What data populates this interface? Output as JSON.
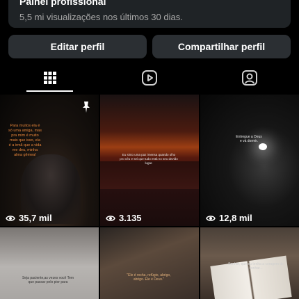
{
  "professional_panel": {
    "title": "Painel profissional",
    "subtitle": "5,5 mi visualizações nos últimos 30 dias."
  },
  "actions": {
    "edit_profile": "Editar perfil",
    "share_profile": "Compartilhar perfil"
  },
  "tabs": [
    {
      "icon": "grid-icon",
      "active": true
    },
    {
      "icon": "reels-icon",
      "active": false
    },
    {
      "icon": "tagged-icon",
      "active": false
    }
  ],
  "posts": [
    {
      "views": "35,7 mil",
      "pinned": true,
      "overlay_text": "Para muitos ela é só uma amiga, mas pra mim é muito mais que isso, ela é a irmã que a vida me deu, minha alma gêmea!"
    },
    {
      "views": "3.135",
      "overlay_text": "Eu sinto uma paz imensa quando olho pro céu e sei que tudo está no seu devido lugar."
    },
    {
      "views": "12,8 mil",
      "overlay_text": "Entregue a Deus e vá dormir."
    },
    {
      "overlay_text": "Seja paciente,as vezes você Tem que passar pelo pior para"
    },
    {
      "overlay_text": "\"Ele é rocha, refúgio, abrigo, abrigo. Ele é Deus.\""
    },
    {
      "overlay_text": "Senhor, que eu tenha a coragem de sonhar..."
    }
  ]
}
